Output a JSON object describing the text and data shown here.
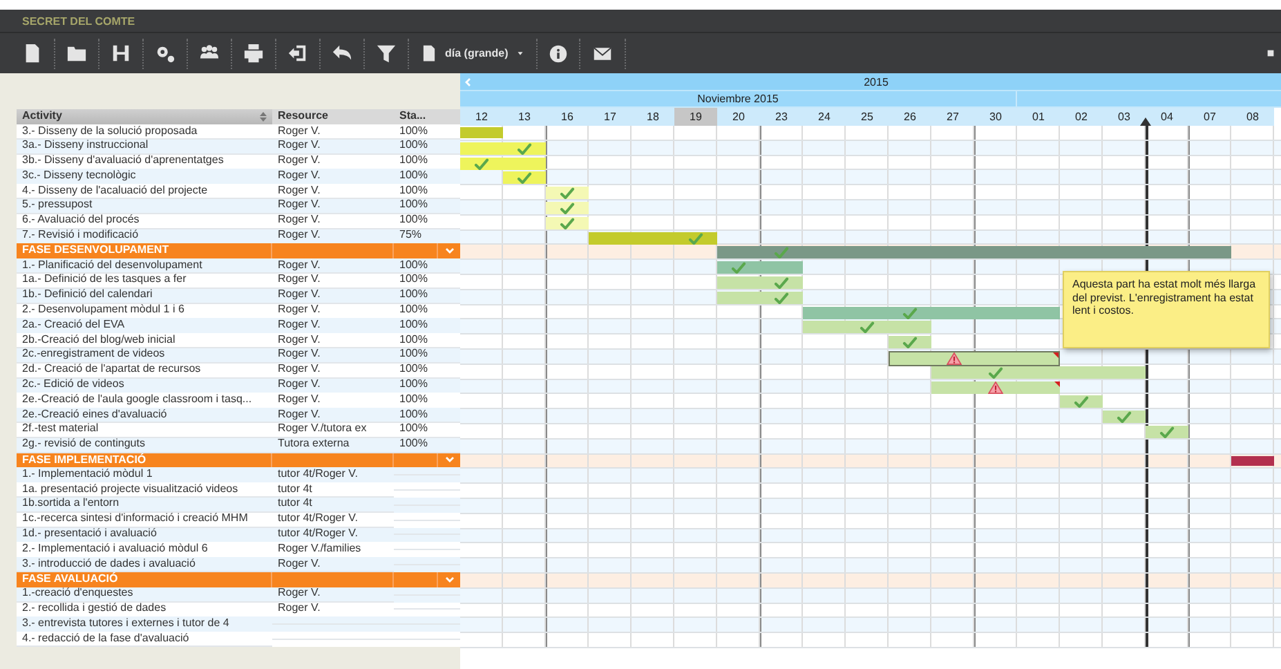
{
  "app": {
    "title": "SECRET DEL COMTE"
  },
  "toolbar": {
    "view_selector": "día (grande)"
  },
  "table": {
    "columns": [
      "Activity",
      "Resource",
      "Sta..."
    ],
    "rows": [
      {
        "kind": "task",
        "activity": "3.- Disseny de la solució proposada",
        "resource": "Roger V.",
        "status": "100%",
        "bar": {
          "color": "#c3cb2c",
          "cells": [
            {
              "kind": "fill"
            }
          ]
        }
      },
      {
        "kind": "task",
        "activity": "3a.- Disseny instruccional",
        "resource": "Roger V.",
        "status": "100%",
        "bar": {
          "color": "#eef45c",
          "cells": [
            {
              "kind": "fill"
            },
            {
              "kind": "check"
            }
          ]
        }
      },
      {
        "kind": "task",
        "activity": "3b.- Disseny d'avaluació d'aprenentatges",
        "resource": "Roger V.",
        "status": "100%",
        "bar": {
          "color": "#eef45c",
          "cells": [
            {
              "kind": "check"
            },
            {
              "kind": "fill"
            }
          ]
        }
      },
      {
        "kind": "task",
        "activity": "3c.- Disseny tecnològic",
        "resource": "Roger V.",
        "status": "100%",
        "bar": {
          "color": "#eef45c",
          "cells": [
            {
              "kind": "gap"
            },
            {
              "kind": "check"
            }
          ]
        }
      },
      {
        "kind": "task",
        "activity": "4.- Disseny de l'acaluació del projecte",
        "resource": "Roger V.",
        "status": "100%",
        "bar": {
          "color": "#f4f8b4",
          "cells": [
            {
              "kind": "gap"
            },
            {
              "kind": "gap"
            },
            {
              "kind": "check"
            }
          ]
        }
      },
      {
        "kind": "task",
        "activity": "5.- pressupost",
        "resource": "Roger V.",
        "status": "100%",
        "bar": {
          "color": "#f4f8b4",
          "cells": [
            {
              "kind": "gap"
            },
            {
              "kind": "gap"
            },
            {
              "kind": "check"
            }
          ]
        }
      },
      {
        "kind": "task",
        "activity": "6.- Avaluació del procés",
        "resource": "Roger V.",
        "status": "100%",
        "bar": {
          "color": "#f4f8b4",
          "cells": [
            {
              "kind": "gap"
            },
            {
              "kind": "gap"
            },
            {
              "kind": "check"
            }
          ]
        }
      },
      {
        "kind": "task",
        "activity": "7.- Revisió i modificació",
        "resource": "Roger V.",
        "status": "75%",
        "bar": {
          "color": "#c3cb2c",
          "cells": [
            {
              "kind": "gap"
            },
            {
              "kind": "gap"
            },
            {
              "kind": "gap"
            },
            {
              "kind": "fill"
            },
            {
              "kind": "fill"
            },
            {
              "kind": "check"
            }
          ]
        }
      },
      {
        "kind": "phase",
        "activity": "FASE DESENVOLUPAMENT",
        "bar": {
          "color": "#7a9887",
          "cells": [
            {
              "kind": "gap"
            },
            {
              "kind": "gap"
            },
            {
              "kind": "gap"
            },
            {
              "kind": "gap"
            },
            {
              "kind": "gap"
            },
            {
              "kind": "gap"
            },
            {
              "kind": "fill"
            },
            {
              "kind": "check"
            },
            {
              "kind": "fill"
            },
            {
              "kind": "fill"
            },
            {
              "kind": "fill"
            },
            {
              "kind": "fill"
            },
            {
              "kind": "fill"
            },
            {
              "kind": "fill"
            },
            {
              "kind": "fill"
            },
            {
              "kind": "fill"
            },
            {
              "kind": "fill"
            },
            {
              "kind": "fill"
            }
          ]
        }
      },
      {
        "kind": "task",
        "activity": "1.- Planificació del desenvolupament",
        "resource": "Roger V.",
        "status": "100%",
        "bar": {
          "color": "#8fc4a4",
          "cells": [
            {
              "kind": "gap"
            },
            {
              "kind": "gap"
            },
            {
              "kind": "gap"
            },
            {
              "kind": "gap"
            },
            {
              "kind": "gap"
            },
            {
              "kind": "gap"
            },
            {
              "kind": "check"
            },
            {
              "kind": "fill"
            }
          ]
        }
      },
      {
        "kind": "task",
        "activity": "1a.- Definició de les tasques a fer",
        "resource": "Roger V.",
        "status": "100%",
        "bar": {
          "color": "#c6e2a6",
          "cells": [
            {
              "kind": "gap"
            },
            {
              "kind": "gap"
            },
            {
              "kind": "gap"
            },
            {
              "kind": "gap"
            },
            {
              "kind": "gap"
            },
            {
              "kind": "gap"
            },
            {
              "kind": "fill"
            },
            {
              "kind": "check"
            }
          ]
        }
      },
      {
        "kind": "task",
        "activity": "1b.- Definició del calendari",
        "resource": "Roger V.",
        "status": "100%",
        "bar": {
          "color": "#c6e2a6",
          "cells": [
            {
              "kind": "gap"
            },
            {
              "kind": "gap"
            },
            {
              "kind": "gap"
            },
            {
              "kind": "gap"
            },
            {
              "kind": "gap"
            },
            {
              "kind": "gap"
            },
            {
              "kind": "fill"
            },
            {
              "kind": "check"
            }
          ]
        }
      },
      {
        "kind": "task",
        "activity": "2.- Desenvolupament mòdul 1 i 6",
        "resource": "Roger V.",
        "status": "100%",
        "bar": {
          "color": "#8fc4a4",
          "cells": [
            {
              "kind": "gap"
            },
            {
              "kind": "gap"
            },
            {
              "kind": "gap"
            },
            {
              "kind": "gap"
            },
            {
              "kind": "gap"
            },
            {
              "kind": "gap"
            },
            {
              "kind": "gap"
            },
            {
              "kind": "gap"
            },
            {
              "kind": "fill"
            },
            {
              "kind": "fill"
            },
            {
              "kind": "check"
            },
            {
              "kind": "fill"
            },
            {
              "kind": "fill"
            },
            {
              "kind": "fill"
            }
          ]
        }
      },
      {
        "kind": "task",
        "activity": "2a.- Creació del EVA",
        "resource": "Roger V.",
        "status": "100%",
        "bar": {
          "color": "#c6e2a6",
          "cells": [
            {
              "kind": "gap"
            },
            {
              "kind": "gap"
            },
            {
              "kind": "gap"
            },
            {
              "kind": "gap"
            },
            {
              "kind": "gap"
            },
            {
              "kind": "gap"
            },
            {
              "kind": "gap"
            },
            {
              "kind": "gap"
            },
            {
              "kind": "fill"
            },
            {
              "kind": "check"
            },
            {
              "kind": "fill"
            }
          ]
        }
      },
      {
        "kind": "task",
        "activity": "2b.-Creació del blog/web inicial",
        "resource": "Roger V.",
        "status": "100%",
        "bar": {
          "color": "#c6e2a6",
          "cells": [
            {
              "kind": "gap"
            },
            {
              "kind": "gap"
            },
            {
              "kind": "gap"
            },
            {
              "kind": "gap"
            },
            {
              "kind": "gap"
            },
            {
              "kind": "gap"
            },
            {
              "kind": "gap"
            },
            {
              "kind": "gap"
            },
            {
              "kind": "gap"
            },
            {
              "kind": "gap"
            },
            {
              "kind": "check"
            }
          ]
        }
      },
      {
        "kind": "task",
        "activity": "2c.-enregistrament de videos",
        "resource": "Roger V.",
        "status": "100%",
        "bar": {
          "color": "#c6e2a6",
          "outlined": true,
          "flagged": true,
          "cells": [
            {
              "kind": "gap"
            },
            {
              "kind": "gap"
            },
            {
              "kind": "gap"
            },
            {
              "kind": "gap"
            },
            {
              "kind": "gap"
            },
            {
              "kind": "gap"
            },
            {
              "kind": "gap"
            },
            {
              "kind": "gap"
            },
            {
              "kind": "gap"
            },
            {
              "kind": "gap"
            },
            {
              "kind": "fill"
            },
            {
              "kind": "warning"
            },
            {
              "kind": "fill"
            },
            {
              "kind": "fill"
            }
          ]
        }
      },
      {
        "kind": "task",
        "activity": "2d.- Creació de l'apartat de recursos",
        "resource": "Roger V.",
        "status": "100%",
        "bar": {
          "color": "#c6e2a6",
          "cells": [
            {
              "kind": "gap"
            },
            {
              "kind": "gap"
            },
            {
              "kind": "gap"
            },
            {
              "kind": "gap"
            },
            {
              "kind": "gap"
            },
            {
              "kind": "gap"
            },
            {
              "kind": "gap"
            },
            {
              "kind": "gap"
            },
            {
              "kind": "gap"
            },
            {
              "kind": "gap"
            },
            {
              "kind": "gap"
            },
            {
              "kind": "fill"
            },
            {
              "kind": "check"
            },
            {
              "kind": "fill"
            },
            {
              "kind": "fill"
            },
            {
              "kind": "fill"
            }
          ]
        }
      },
      {
        "kind": "task",
        "activity": "2c.- Edició de videos",
        "resource": "Roger V.",
        "status": "100%",
        "bar": {
          "color": "#c6e2a6",
          "outlined": false,
          "flagged": true,
          "cells": [
            {
              "kind": "gap"
            },
            {
              "kind": "gap"
            },
            {
              "kind": "gap"
            },
            {
              "kind": "gap"
            },
            {
              "kind": "gap"
            },
            {
              "kind": "gap"
            },
            {
              "kind": "gap"
            },
            {
              "kind": "gap"
            },
            {
              "kind": "gap"
            },
            {
              "kind": "gap"
            },
            {
              "kind": "gap"
            },
            {
              "kind": "fill"
            },
            {
              "kind": "warning"
            },
            {
              "kind": "fill"
            }
          ]
        }
      },
      {
        "kind": "task",
        "activity": "2e.-Creació de l'aula google classroom i tasq...",
        "resource": "Roger V.",
        "status": "100%",
        "bar": {
          "color": "#c6e2a6",
          "cells": [
            {
              "kind": "gap"
            },
            {
              "kind": "gap"
            },
            {
              "kind": "gap"
            },
            {
              "kind": "gap"
            },
            {
              "kind": "gap"
            },
            {
              "kind": "gap"
            },
            {
              "kind": "gap"
            },
            {
              "kind": "gap"
            },
            {
              "kind": "gap"
            },
            {
              "kind": "gap"
            },
            {
              "kind": "gap"
            },
            {
              "kind": "gap"
            },
            {
              "kind": "gap"
            },
            {
              "kind": "gap"
            },
            {
              "kind": "check"
            }
          ]
        }
      },
      {
        "kind": "task",
        "activity": "2e.-Creació eines d'avaluació",
        "resource": "Roger V.",
        "status": "100%",
        "bar": {
          "color": "#c6e2a6",
          "cells": [
            {
              "kind": "gap"
            },
            {
              "kind": "gap"
            },
            {
              "kind": "gap"
            },
            {
              "kind": "gap"
            },
            {
              "kind": "gap"
            },
            {
              "kind": "gap"
            },
            {
              "kind": "gap"
            },
            {
              "kind": "gap"
            },
            {
              "kind": "gap"
            },
            {
              "kind": "gap"
            },
            {
              "kind": "gap"
            },
            {
              "kind": "gap"
            },
            {
              "kind": "gap"
            },
            {
              "kind": "gap"
            },
            {
              "kind": "gap"
            },
            {
              "kind": "check"
            }
          ]
        }
      },
      {
        "kind": "task",
        "activity": "2f.-test material",
        "resource": "Roger V./tutora ex",
        "status": "100%",
        "bar": {
          "color": "#c6e2a6",
          "cells": [
            {
              "kind": "gap"
            },
            {
              "kind": "gap"
            },
            {
              "kind": "gap"
            },
            {
              "kind": "gap"
            },
            {
              "kind": "gap"
            },
            {
              "kind": "gap"
            },
            {
              "kind": "gap"
            },
            {
              "kind": "gap"
            },
            {
              "kind": "gap"
            },
            {
              "kind": "gap"
            },
            {
              "kind": "gap"
            },
            {
              "kind": "gap"
            },
            {
              "kind": "gap"
            },
            {
              "kind": "gap"
            },
            {
              "kind": "gap"
            },
            {
              "kind": "gap"
            },
            {
              "kind": "check"
            }
          ]
        }
      },
      {
        "kind": "task",
        "activity": "2g.- revisió de continguts",
        "resource": "Tutora externa",
        "status": "100%"
      },
      {
        "kind": "phase",
        "activity": "FASE IMPLEMENTACIÓ",
        "bar": {
          "color": "#b3304e",
          "cells": [
            {
              "kind": "gap"
            },
            {
              "kind": "gap"
            },
            {
              "kind": "gap"
            },
            {
              "kind": "gap"
            },
            {
              "kind": "gap"
            },
            {
              "kind": "gap"
            },
            {
              "kind": "gap"
            },
            {
              "kind": "gap"
            },
            {
              "kind": "gap"
            },
            {
              "kind": "gap"
            },
            {
              "kind": "gap"
            },
            {
              "kind": "gap"
            },
            {
              "kind": "gap"
            },
            {
              "kind": "gap"
            },
            {
              "kind": "gap"
            },
            {
              "kind": "gap"
            },
            {
              "kind": "gap"
            },
            {
              "kind": "gap"
            },
            {
              "kind": "fill"
            }
          ]
        }
      },
      {
        "kind": "task",
        "activity": "1.- Implementació mòdul 1",
        "resource": "tutor 4t/Roger V."
      },
      {
        "kind": "task",
        "activity": "1a. presentació projecte visualització videos",
        "resource": "tutor 4t"
      },
      {
        "kind": "task",
        "activity": "1b.sortida a l'entorn",
        "resource": "tutor 4t"
      },
      {
        "kind": "task",
        "activity": "1c.-recerca sintesi d'informació i creació MHM",
        "resource": "tutor 4t/Roger V."
      },
      {
        "kind": "task",
        "activity": "1d.- presentació i avaluació",
        "resource": "tutor 4t/Roger V."
      },
      {
        "kind": "task",
        "activity": "2.- Implementació i avaluació mòdul 6",
        "resource": "Roger V./families"
      },
      {
        "kind": "task",
        "activity": "3.- introducció de dades i avaluació",
        "resource": "Roger V."
      },
      {
        "kind": "phase",
        "activity": "FASE AVALUACIÓ"
      },
      {
        "kind": "task",
        "activity": "1.-creació d'enquestes",
        "resource": "Roger V."
      },
      {
        "kind": "task",
        "activity": "2.- recollida i gestió de dades",
        "resource": "Roger V."
      },
      {
        "kind": "task",
        "activity": "3.- entrevista tutores i externes i tutor de 4"
      },
      {
        "kind": "task",
        "activity": "4.- redacció de la fase d'avaluació"
      }
    ]
  },
  "timeline": {
    "year": "2015",
    "month": "Noviembre 2015",
    "days": [
      {
        "label": "12",
        "selected": false,
        "today": false
      },
      {
        "label": "13",
        "selected": false,
        "today": false
      },
      {
        "label": "16",
        "selected": false,
        "today": false
      },
      {
        "label": "17",
        "selected": false,
        "today": false
      },
      {
        "label": "18",
        "selected": false,
        "today": false
      },
      {
        "label": "19",
        "selected": true,
        "today": false
      },
      {
        "label": "20",
        "selected": false,
        "today": false
      },
      {
        "label": "23",
        "selected": false,
        "today": false
      },
      {
        "label": "24",
        "selected": false,
        "today": false
      },
      {
        "label": "25",
        "selected": false,
        "today": false
      },
      {
        "label": "26",
        "selected": false,
        "today": false
      },
      {
        "label": "27",
        "selected": false,
        "today": false
      },
      {
        "label": "30",
        "selected": false,
        "today": false
      },
      {
        "label": "01",
        "selected": false,
        "today": false
      },
      {
        "label": "02",
        "selected": false,
        "today": false
      },
      {
        "label": "03",
        "selected": false,
        "today": false
      },
      {
        "label": "04",
        "selected": false,
        "today": true
      },
      {
        "label": "07",
        "selected": false,
        "today": false
      },
      {
        "label": "08",
        "selected": false,
        "today": false
      }
    ],
    "note": "Aquesta part ha estat molt més llarga del previst. L'enregistrament ha estat lent i costos."
  }
}
